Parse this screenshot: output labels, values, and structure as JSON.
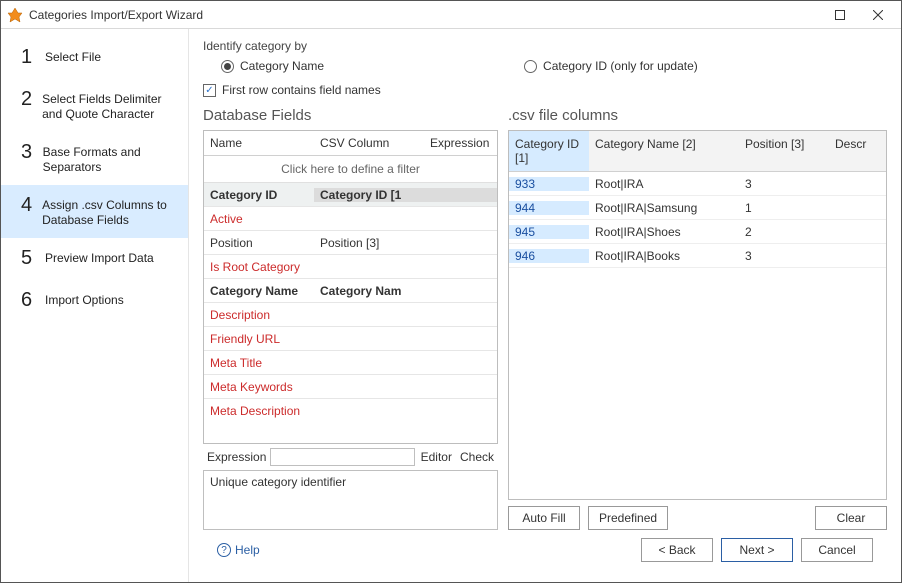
{
  "window": {
    "title": "Categories Import/Export Wizard"
  },
  "sidebar": {
    "steps": [
      {
        "num": "1",
        "label": "Select File"
      },
      {
        "num": "2",
        "label": "Select Fields Delimiter and Quote Character"
      },
      {
        "num": "3",
        "label": "Base Formats and Separators"
      },
      {
        "num": "4",
        "label": "Assign .csv Columns to Database Fields"
      },
      {
        "num": "5",
        "label": "Preview Import Data"
      },
      {
        "num": "6",
        "label": "Import Options"
      }
    ],
    "active_index": 3
  },
  "identify": {
    "label": "Identify category by",
    "options": [
      {
        "label": "Category Name",
        "checked": true
      },
      {
        "label": "Category ID (only for update)",
        "checked": false
      }
    ]
  },
  "firstRow": {
    "label": "First row contains field names",
    "checked": true
  },
  "dbFields": {
    "title": "Database Fields",
    "headers": {
      "name": "Name",
      "csv": "CSV Column",
      "expr": "Expression"
    },
    "filter_text": "Click here to define a filter",
    "rows": [
      {
        "name": "Category ID",
        "csv": "Category ID [1",
        "selected": true
      },
      {
        "name": "Active",
        "red": true
      },
      {
        "name": "Position",
        "csv": "Position [3]"
      },
      {
        "name": "Is Root Category",
        "red": true
      },
      {
        "name": "Category Name",
        "csv": "Category Nam",
        "bold": true
      },
      {
        "name": "Description",
        "red": true
      },
      {
        "name": "Friendly URL",
        "red": true
      },
      {
        "name": "Meta Title",
        "red": true
      },
      {
        "name": "Meta Keywords",
        "red": true
      },
      {
        "name": "Meta Description",
        "red": true
      }
    ],
    "expression": {
      "label": "Expression",
      "editor": "Editor",
      "check": "Check"
    },
    "description": "Unique category identifier"
  },
  "csv": {
    "title": ".csv file columns",
    "headers": [
      "Category ID [1]",
      "Category Name [2]",
      "Position [3]",
      "Descr"
    ],
    "rows": [
      {
        "id": "933",
        "name": "Root|IRA",
        "pos": "3"
      },
      {
        "id": "944",
        "name": "Root|IRA|Samsung",
        "pos": "1"
      },
      {
        "id": "945",
        "name": "Root|IRA|Shoes",
        "pos": "2"
      },
      {
        "id": "946",
        "name": "Root|IRA|Books",
        "pos": "3"
      }
    ],
    "buttons": {
      "autofill": "Auto Fill",
      "predefined": "Predefined",
      "clear": "Clear"
    }
  },
  "footer": {
    "help": "Help",
    "back": "< Back",
    "next": "Next >",
    "cancel": "Cancel"
  }
}
